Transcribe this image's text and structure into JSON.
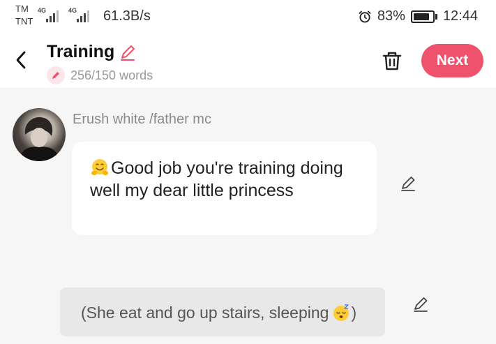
{
  "status_bar": {
    "carrier_top": "TM",
    "carrier_bottom": "TNT",
    "network_1": "4G",
    "network_2": "4G",
    "net_speed": "61.3B/s",
    "alarm_icon": "alarm-clock-icon",
    "battery": "83%",
    "battery_level": 0.83,
    "time": "12:44"
  },
  "header": {
    "back_icon": "chevron-left-icon",
    "title": "Training",
    "title_edit_icon": "pencil-icon",
    "words": "256/150 words",
    "delete_icon": "trash-icon",
    "next_label": "Next",
    "accent_color": "#f0526d"
  },
  "chat": {
    "sender_name": "Erush white /father mc",
    "message": "Good job you're training doing well my dear little princess",
    "message_emoji": "hugging-face-emoji",
    "narration": "(She eat and go up stairs, sleeping",
    "narration_end": ")",
    "narration_emoji": "sleeping-face-emoji"
  }
}
